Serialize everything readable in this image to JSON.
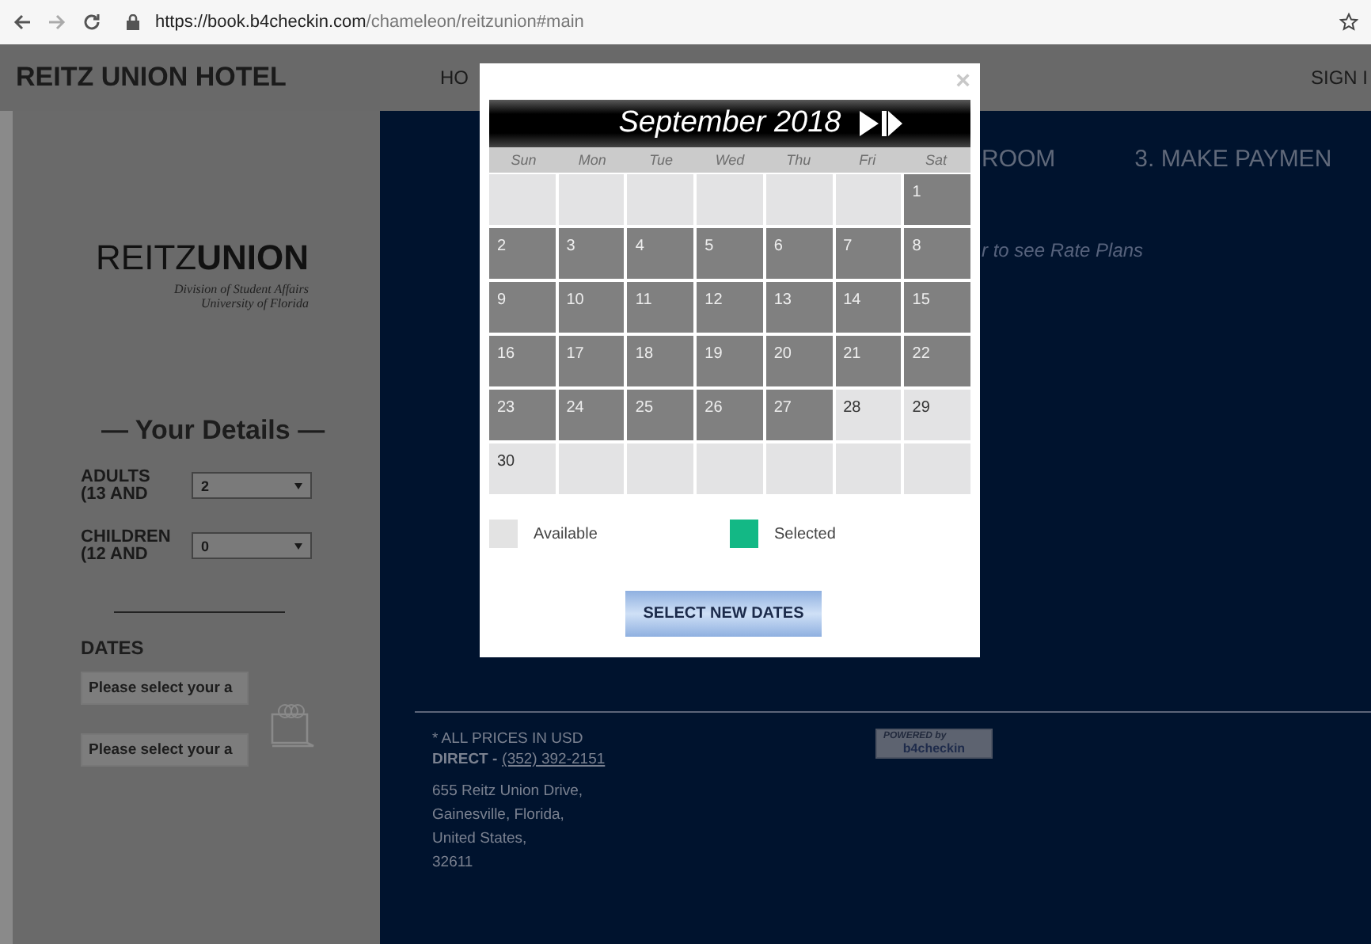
{
  "browser": {
    "url_host": "https://book.b4checkin.com",
    "url_path": "/chameleon/reitzunion#main"
  },
  "header": {
    "title": "REITZ UNION HOTEL",
    "nav_left": "HO",
    "nav_right": "SIGN I"
  },
  "sidebar": {
    "logo": "REITZ**UNION**",
    "logo_sub": [
      "Division of Student Affairs",
      "University of Florida"
    ],
    "heading": "— Your Details —",
    "fields": [
      {
        "label": "ADULTS (13 AND",
        "value": "2"
      },
      {
        "label": "CHILDREN (12 AND",
        "value": "0"
      }
    ],
    "dates_label": "DATES",
    "date_inputs": [
      "Please select your a",
      "Please select your a"
    ]
  },
  "steps": [
    "ROOM",
    "3. MAKE PAYMEN"
  ],
  "hint": "r to see Rate Plans",
  "footer": {
    "prices": "* ALL PRICES IN USD",
    "direct_label": "DIRECT -",
    "phone": "(352) 392-2151",
    "address": [
      "655 Reitz Union Drive,",
      "Gainesville, Florida,",
      "United States,",
      "32611"
    ],
    "powered_top": "POWERED by",
    "powered_brand": "b4checkin"
  },
  "calendar": {
    "close": "×",
    "month": "September 2018",
    "weekdays": [
      "Sun",
      "Mon",
      "Tue",
      "Wed",
      "Thu",
      "Fri",
      "Sat"
    ],
    "weeks": [
      [
        {
          "kind": "empty"
        },
        {
          "kind": "empty"
        },
        {
          "kind": "empty"
        },
        {
          "kind": "empty"
        },
        {
          "kind": "empty"
        },
        {
          "kind": "empty"
        },
        {
          "kind": "day",
          "day": "1",
          "available": false
        }
      ],
      [
        {
          "kind": "day",
          "day": "2",
          "available": false
        },
        {
          "kind": "day",
          "day": "3",
          "available": false
        },
        {
          "kind": "day",
          "day": "4",
          "available": false
        },
        {
          "kind": "day",
          "day": "5",
          "available": false
        },
        {
          "kind": "day",
          "day": "6",
          "available": false
        },
        {
          "kind": "day",
          "day": "7",
          "available": false
        },
        {
          "kind": "day",
          "day": "8",
          "available": false
        }
      ],
      [
        {
          "kind": "day",
          "day": "9",
          "available": false
        },
        {
          "kind": "day",
          "day": "10",
          "available": false
        },
        {
          "kind": "day",
          "day": "11",
          "available": false
        },
        {
          "kind": "day",
          "day": "12",
          "available": false
        },
        {
          "kind": "day",
          "day": "13",
          "available": false
        },
        {
          "kind": "day",
          "day": "14",
          "available": false
        },
        {
          "kind": "day",
          "day": "15",
          "available": false
        }
      ],
      [
        {
          "kind": "day",
          "day": "16",
          "available": false
        },
        {
          "kind": "day",
          "day": "17",
          "available": false
        },
        {
          "kind": "day",
          "day": "18",
          "available": false
        },
        {
          "kind": "day",
          "day": "19",
          "available": false
        },
        {
          "kind": "day",
          "day": "20",
          "available": false
        },
        {
          "kind": "day",
          "day": "21",
          "available": false
        },
        {
          "kind": "day",
          "day": "22",
          "available": false
        }
      ],
      [
        {
          "kind": "day",
          "day": "23",
          "available": false
        },
        {
          "kind": "day",
          "day": "24",
          "available": false
        },
        {
          "kind": "day",
          "day": "25",
          "available": false
        },
        {
          "kind": "day",
          "day": "26",
          "available": false
        },
        {
          "kind": "day",
          "day": "27",
          "available": false
        },
        {
          "kind": "day",
          "day": "28",
          "available": true
        },
        {
          "kind": "day",
          "day": "29",
          "available": true
        }
      ],
      [
        {
          "kind": "day",
          "day": "30",
          "available": true
        },
        {
          "kind": "empty"
        },
        {
          "kind": "empty"
        },
        {
          "kind": "empty"
        },
        {
          "kind": "empty"
        },
        {
          "kind": "empty"
        },
        {
          "kind": "empty"
        }
      ]
    ],
    "legend": [
      {
        "label": "Available",
        "color": "#e3e3e3"
      },
      {
        "label": "Selected",
        "color": "#13b885"
      }
    ],
    "button": "SELECT NEW DATES"
  }
}
